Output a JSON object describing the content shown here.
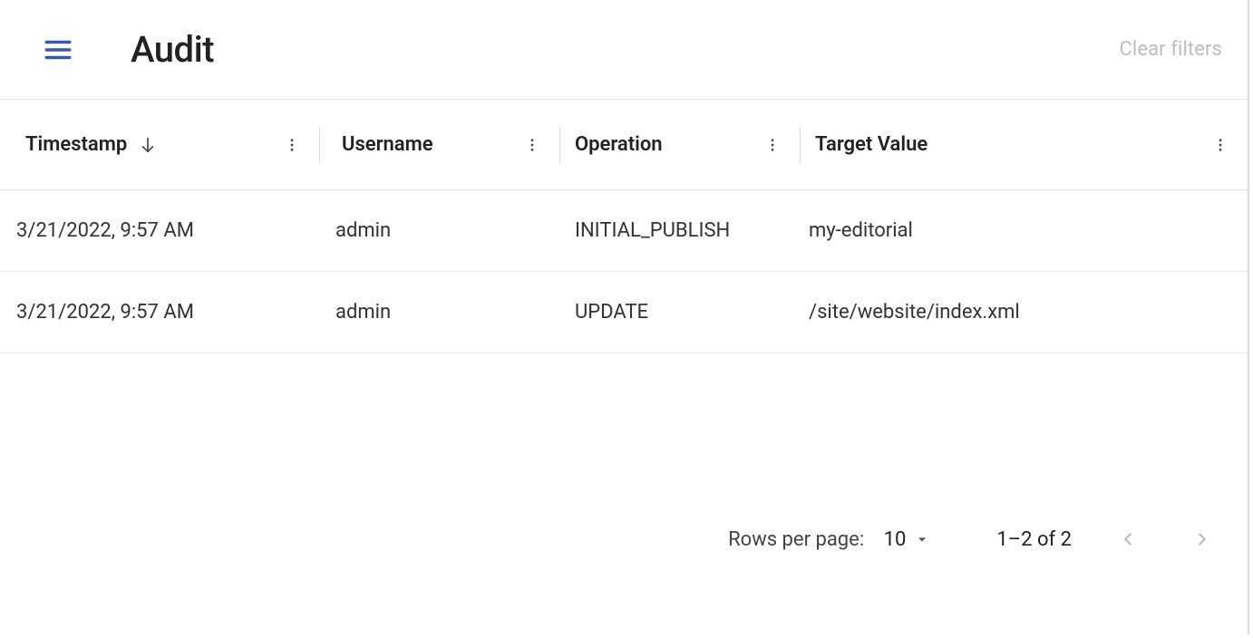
{
  "header": {
    "title": "Audit",
    "clear_filters_label": "Clear filters"
  },
  "table": {
    "columns": {
      "timestamp": "Timestamp",
      "username": "Username",
      "operation": "Operation",
      "target_value": "Target Value"
    },
    "rows": [
      {
        "timestamp": "3/21/2022, 9:57 AM",
        "username": "admin",
        "operation": "INITIAL_PUBLISH",
        "target_value": "my-editorial"
      },
      {
        "timestamp": "3/21/2022, 9:57 AM",
        "username": "admin",
        "operation": "UPDATE",
        "target_value": "/site/website/index.xml"
      }
    ]
  },
  "pagination": {
    "rows_per_page_label": "Rows per page:",
    "rows_per_page_value": "10",
    "range": "1–2 of 2"
  }
}
